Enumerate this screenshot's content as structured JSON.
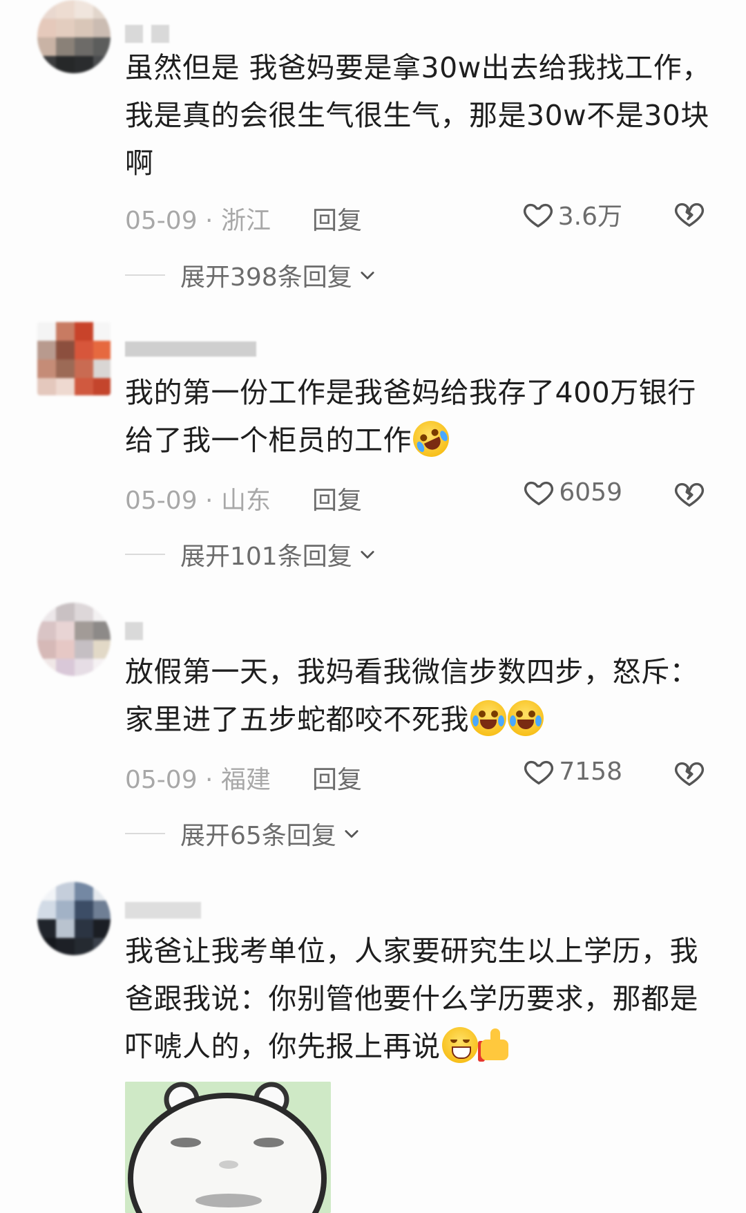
{
  "comments": [
    {
      "text": "虽然但是 我爸妈要是拿30w出去给我找工作，我是真的会很生气很生气，那是30w不是30块啊",
      "date": "05-09 · 浙江",
      "reply": "回复",
      "likes": "3.6万",
      "expand": "展开398条回复"
    },
    {
      "text": "我的第一份工作是我爸妈给我存了400万银行给了我一个柜员的工作",
      "date": "05-09 · 山东",
      "reply": "回复",
      "likes": "6059",
      "expand": "展开101条回复",
      "emoji": "rolling-laughing-emoji"
    },
    {
      "text": "放假第一天，我妈看我微信步数四步，怒斥：家里进了五步蛇都咬不死我",
      "date": "05-09 · 福建",
      "reply": "回复",
      "likes": "7158",
      "expand": "展开65条回复",
      "emoji": "crying-laughing-emoji"
    },
    {
      "text": "我爸让我考单位，人家要研究生以上学历，我爸跟我说：你别管他要什么学历要求，那都是吓唬人的，你先报上再说",
      "emoji": "grin-emoji",
      "emoji2": "thumbs-up-emoji",
      "sticker": "bear-meme-sticker"
    }
  ],
  "icons": {
    "like": "heart-outline-icon",
    "dislike": "broken-heart-icon",
    "chevron": "chevron-down-icon"
  },
  "colors": {
    "text": "#1e1e1e",
    "meta": "#a8a8a8",
    "action": "#6c6c6c",
    "background": "#fdfdfd"
  }
}
